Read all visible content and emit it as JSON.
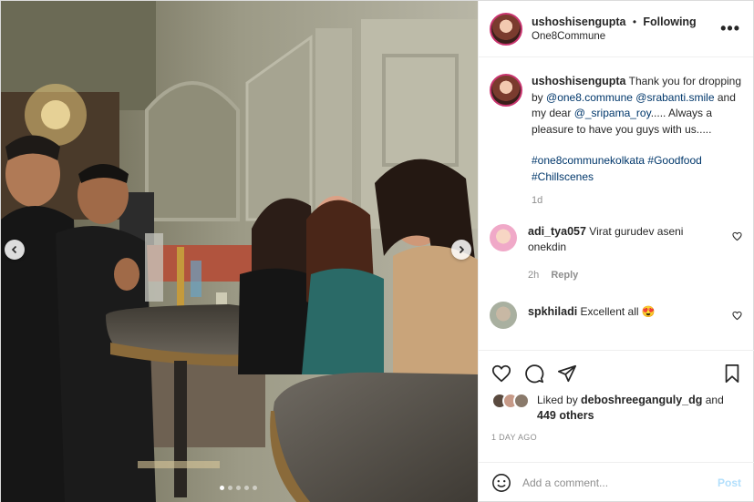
{
  "post": {
    "username": "ushoshisengupta",
    "separator": "•",
    "follow_label": "Following",
    "location": "One8Commune",
    "more_label": "•••"
  },
  "caption": {
    "username": "ushoshisengupta",
    "text_1": "Thank you for dropping by",
    "mention_1": "@one8.commune",
    "mention_2": "@srabanti.smile",
    "text_2": "and my dear",
    "mention_3": "@_sripama_roy",
    "text_3": "..... Always a pleasure to have you guys with us.....",
    "hashtag_1": "#one8communekolkata",
    "hashtag_2": "#Goodfood",
    "hashtag_3": "#Chillscenes",
    "time": "1d"
  },
  "comments": [
    {
      "username": "adi_tya057",
      "text": "Virat gurudev aseni onekdin",
      "time": "2h",
      "reply_label": "Reply",
      "avatar_color": "#f0a9c8"
    },
    {
      "username": "spkhiladi",
      "text": "Excellent all",
      "emoji": "😍",
      "avatar_color": "#a9b0a0"
    }
  ],
  "likes": {
    "prefix": "Liked by",
    "user": "deboshreeganguly_dg",
    "and": "and",
    "others": "449 others",
    "avatar_colors": [
      "#5a4a3f",
      "#c79a88",
      "#8a7a6b"
    ]
  },
  "timestamp": "1 DAY AGO",
  "add_comment": {
    "placeholder": "Add a comment...",
    "post_label": "Post"
  },
  "carousel": {
    "dots": 5,
    "active_index": 0
  },
  "icons": {
    "more": "more-horizontal-icon",
    "like": "heart-icon",
    "comment": "comment-icon",
    "share": "share-icon",
    "save": "bookmark-icon",
    "emoji": "smiley-icon",
    "prev": "chevron-left-icon",
    "next": "chevron-right-icon"
  },
  "colors": {
    "link": "#00376b",
    "muted": "#8e8e8e",
    "post_disabled": "#b2dffc",
    "text": "#262626"
  }
}
